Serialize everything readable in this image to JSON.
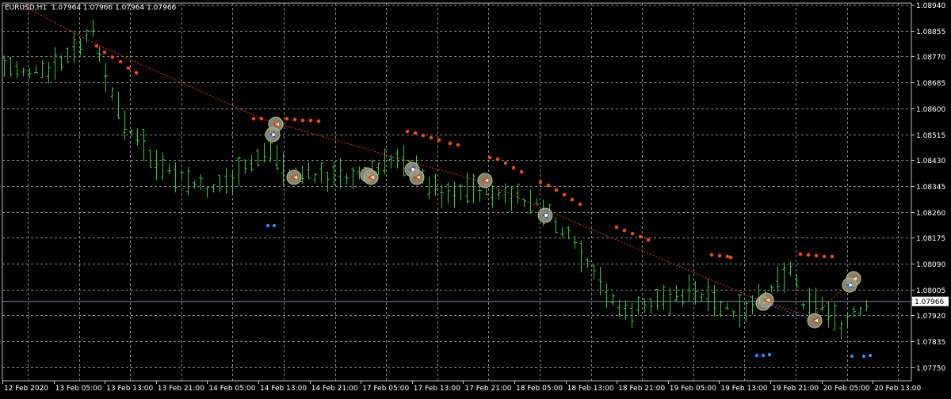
{
  "symbol_info": {
    "text": "EURUSD,H1  1.07964 1.07966 1.07964 1.07966"
  },
  "price_axis": {
    "labels": [
      "1.08940",
      "1.08855",
      "1.08770",
      "1.08685",
      "1.08600",
      "1.08515",
      "1.08430",
      "1.08345",
      "1.08260",
      "1.08175",
      "1.08090",
      "1.08005",
      "1.07920",
      "1.07835",
      "1.07750"
    ],
    "current_price": "1.07966"
  },
  "time_axis": {
    "labels": [
      "12 Feb 2020",
      "13 Feb 05:00",
      "13 Feb 13:00",
      "13 Feb 21:00",
      "14 Feb 05:00",
      "14 Feb 13:00",
      "14 Feb 21:00",
      "17 Feb 05:00",
      "17 Feb 13:00",
      "17 Feb 21:00",
      "18 Feb 05:00",
      "18 Feb 13:00",
      "18 Feb 21:00",
      "19 Feb 05:00",
      "19 Feb 13:00",
      "19 Feb 21:00",
      "20 Feb 05:00",
      "20 Feb 13:00"
    ]
  },
  "colors": {
    "background": "#000000",
    "grid": "#8a8a8a",
    "bars": "#2ecc2e",
    "resistance_dots": "#ff4500",
    "support_dots": "#1e90ff",
    "current_price_line": "#6f8faf",
    "trend_line": "#ff3300"
  },
  "chart_data": {
    "type": "ohlc",
    "symbol": "EURUSD",
    "timeframe": "H1",
    "ylim": [
      1.0775,
      1.0896
    ],
    "current_price": 1.07966,
    "grid": true
  }
}
